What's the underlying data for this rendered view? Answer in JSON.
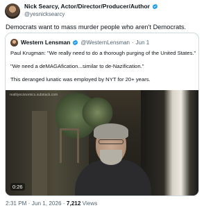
{
  "tweet": {
    "author_name": "Nick Searcy, Actor/Director/Producer/Author",
    "author_handle": "@yesnicksearcy",
    "text": "Democrats want to mass murder people who aren't Democrats.",
    "verified_color": "#1d9bf0"
  },
  "quote": {
    "author_name": "Western Lensman",
    "author_handle": "@WesternLensman",
    "separator": "·",
    "date": "Jun 1",
    "line1": "Paul Krugman: \"We really need to do a thorough purging of the United States.\"",
    "line2": "\"We need a deMAGAfication...similar to de-Nazification.\"",
    "line3": "This deranged lunatic was employed by NYT for 20+ years.",
    "video_watermark": "realityeconomics.substack.com",
    "video_timestamp": "0:26"
  },
  "meta": {
    "time": "2:31 PM",
    "date": "Jun 1, 2026",
    "separator": "·",
    "views_count": "7,212",
    "views_label": "Views"
  }
}
